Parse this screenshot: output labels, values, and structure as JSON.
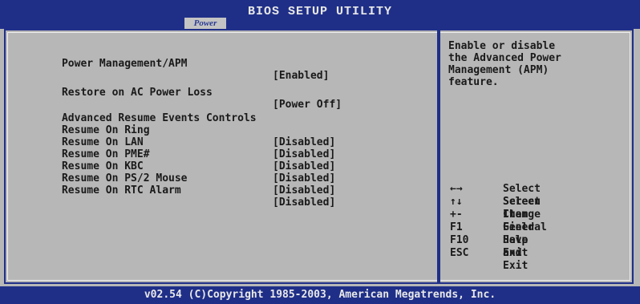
{
  "header": {
    "title": "BIOS SETUP UTILITY",
    "active_tab": "Power"
  },
  "settings": [
    {
      "label": "Power Management/APM",
      "value": "[Enabled]"
    },
    {
      "label": "Restore on AC Power Loss",
      "value": "[Power Off]"
    },
    {
      "label": "Advanced Resume Events Controls",
      "value": ""
    },
    {
      "label": "Resume On Ring",
      "value": "[Disabled]"
    },
    {
      "label": "Resume On LAN",
      "value": "[Disabled]"
    },
    {
      "label": "Resume On PME#",
      "value": "[Disabled]"
    },
    {
      "label": "Resume On KBC",
      "value": "[Disabled]"
    },
    {
      "label": "Resume On PS/2 Mouse",
      "value": "[Disabled]"
    },
    {
      "label": "Resume On RTC Alarm",
      "value": "[Disabled]"
    }
  ],
  "help_text": "Enable or disable\nthe Advanced Power\nManagement (APM)\nfeature.",
  "keys": [
    {
      "key": "←→",
      "desc": "Select Screen"
    },
    {
      "key": "↑↓",
      "desc": "Select Item"
    },
    {
      "key": "+-",
      "desc": "Change Field"
    },
    {
      "key": "F1",
      "desc": "General Help"
    },
    {
      "key": "F10",
      "desc": "Save and Exit"
    },
    {
      "key": "ESC",
      "desc": "Exit"
    }
  ],
  "footer": "v02.54 (C)Copyright 1985-2003, American Megatrends, Inc.",
  "colors": {
    "accent": "#1f2f88",
    "panel": "#b7b7b7"
  }
}
